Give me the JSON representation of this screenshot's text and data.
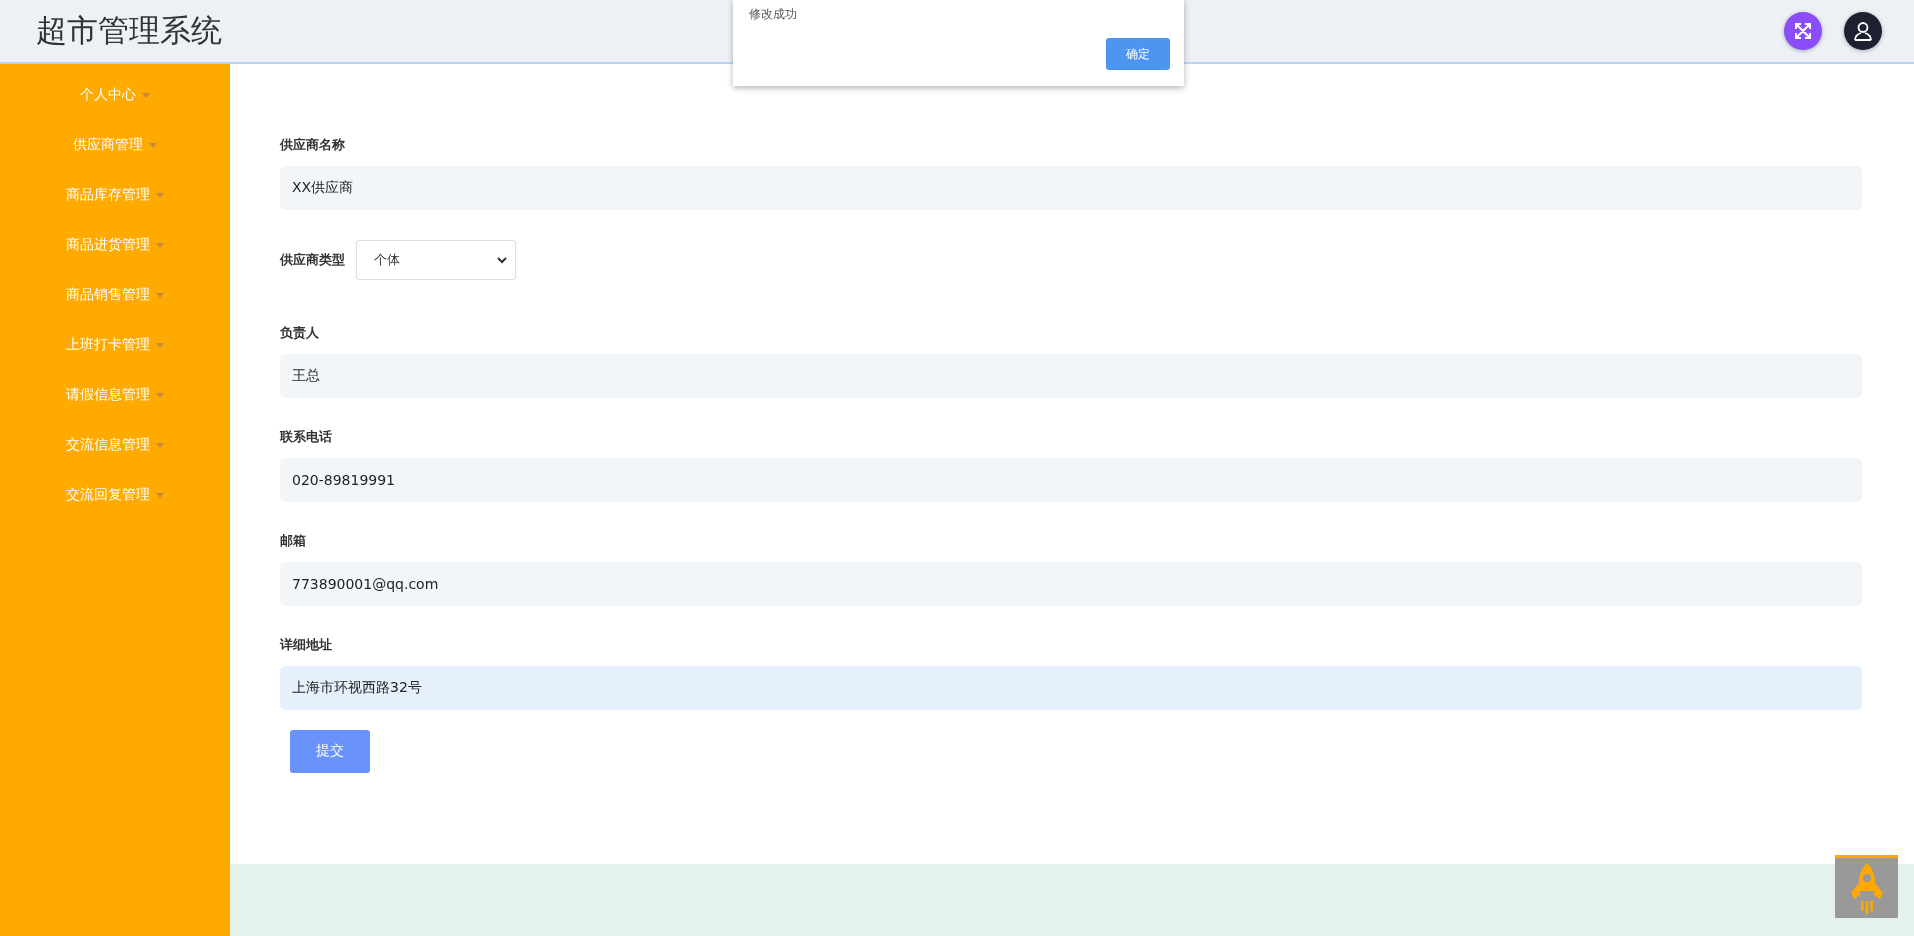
{
  "header": {
    "title": "超市管理系统"
  },
  "sidebar": {
    "items": [
      {
        "label": "个人中心"
      },
      {
        "label": "供应商管理"
      },
      {
        "label": "商品库存管理"
      },
      {
        "label": "商品进货管理"
      },
      {
        "label": "商品销售管理"
      },
      {
        "label": "上班打卡管理"
      },
      {
        "label": "请假信息管理"
      },
      {
        "label": "交流信息管理"
      },
      {
        "label": "交流回复管理"
      }
    ]
  },
  "form": {
    "fields": [
      {
        "kind": "input",
        "label": "供应商名称",
        "value": "XX供应商",
        "focused": false
      },
      {
        "kind": "select",
        "label": "供应商类型",
        "value": "个体"
      },
      {
        "kind": "input",
        "label": "负责人",
        "value": "王总",
        "focused": false
      },
      {
        "kind": "input",
        "label": "联系电话",
        "value": "020-89819991",
        "focused": false
      },
      {
        "kind": "input",
        "label": "邮箱",
        "value": "773890001@qq.com",
        "focused": false
      },
      {
        "kind": "input",
        "label": "详细地址",
        "value": "上海市环视西路32号",
        "focused": true
      }
    ],
    "submit": "提交"
  },
  "dialog": {
    "message": "修改成功",
    "button": "确定"
  }
}
